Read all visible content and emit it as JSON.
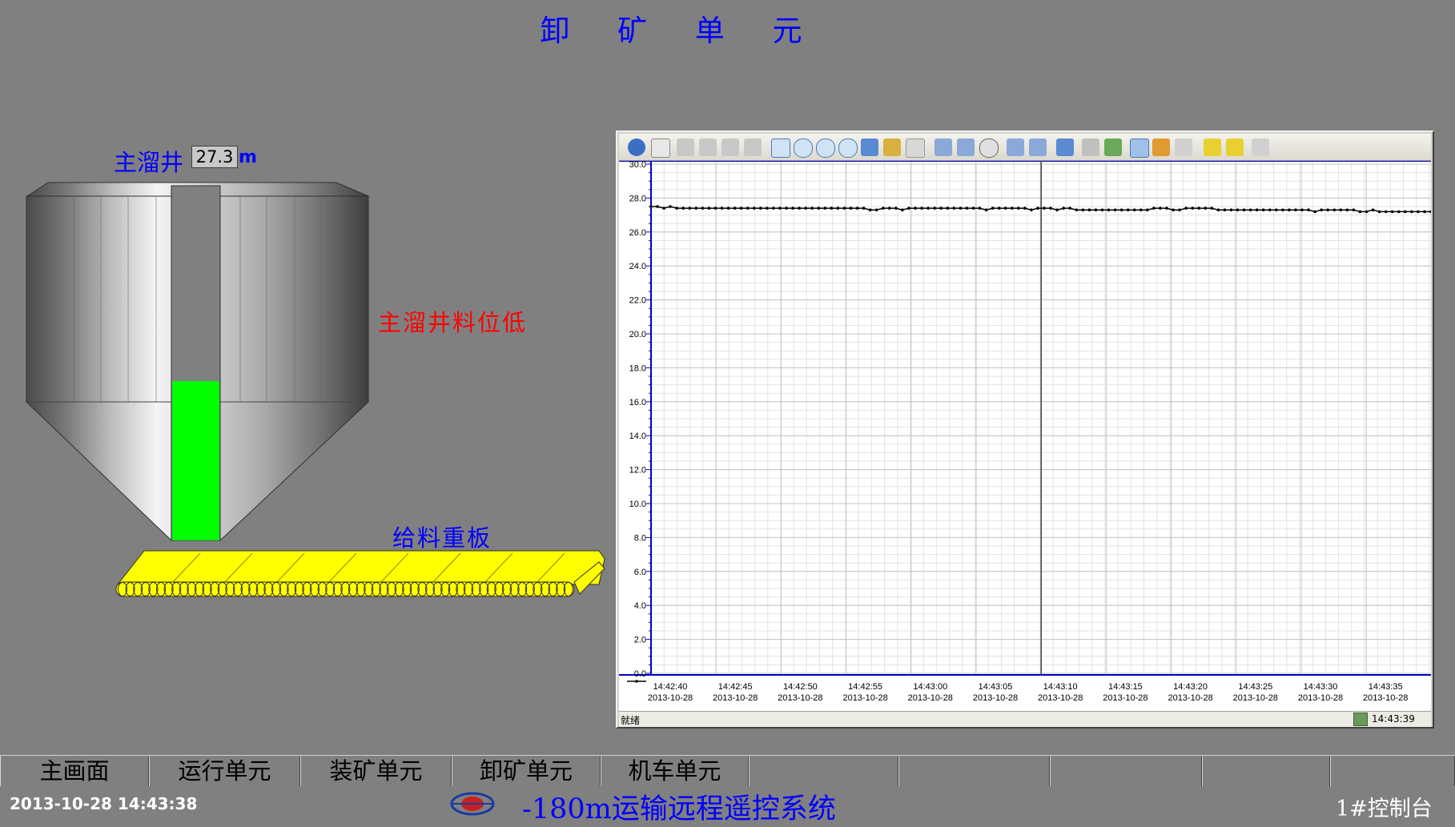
{
  "page": {
    "title": "卸 矿 单 元"
  },
  "shaft": {
    "label": "主溜井",
    "level_value": "27.3",
    "unit": "m",
    "alarm": "主溜井料位低",
    "fill_fraction": 0.45
  },
  "feeder": {
    "label": "给料重板"
  },
  "chart_data": {
    "type": "line",
    "ylim": [
      0,
      30
    ],
    "y_ticks": [
      "0.0",
      "2.0",
      "4.0",
      "6.0",
      "8.0",
      "10.0",
      "12.0",
      "14.0",
      "16.0",
      "18.0",
      "20.0",
      "22.0",
      "24.0",
      "26.0",
      "28.0",
      "30.0"
    ],
    "x_ticks": [
      {
        "time": "14:42:40",
        "date": "2013-10-28"
      },
      {
        "time": "14:42:45",
        "date": "2013-10-28"
      },
      {
        "time": "14:42:50",
        "date": "2013-10-28"
      },
      {
        "time": "14:42:55",
        "date": "2013-10-28"
      },
      {
        "time": "14:43:00",
        "date": "2013-10-28"
      },
      {
        "time": "14:43:05",
        "date": "2013-10-28"
      },
      {
        "time": "14:43:10",
        "date": "2013-10-28"
      },
      {
        "time": "14:43:15",
        "date": "2013-10-28"
      },
      {
        "time": "14:43:20",
        "date": "2013-10-28"
      },
      {
        "time": "14:43:25",
        "date": "2013-10-28"
      },
      {
        "time": "14:43:30",
        "date": "2013-10-28"
      },
      {
        "time": "14:43:35",
        "date": "2013-10-28"
      }
    ],
    "series": [
      {
        "values": [
          27.5,
          27.5,
          27.4,
          27.5,
          27.4,
          27.4,
          27.4,
          27.4,
          27.4,
          27.4,
          27.4,
          27.4,
          27.4,
          27.4,
          27.4,
          27.4,
          27.4,
          27.4,
          27.4,
          27.4,
          27.4,
          27.4,
          27.4,
          27.4,
          27.4,
          27.4,
          27.4,
          27.4,
          27.4,
          27.4,
          27.4,
          27.4,
          27.4,
          27.4,
          27.3,
          27.3,
          27.4,
          27.4,
          27.4,
          27.3,
          27.4,
          27.4,
          27.4,
          27.4,
          27.4,
          27.4,
          27.4,
          27.4,
          27.4,
          27.4,
          27.4,
          27.4,
          27.3,
          27.4,
          27.4,
          27.4,
          27.4,
          27.4,
          27.4,
          27.3,
          27.4,
          27.4,
          27.4,
          27.3,
          27.4,
          27.4,
          27.3,
          27.3,
          27.3,
          27.3,
          27.3,
          27.3,
          27.3,
          27.3,
          27.3,
          27.3,
          27.3,
          27.3,
          27.4,
          27.4,
          27.4,
          27.3,
          27.3,
          27.4,
          27.4,
          27.4,
          27.4,
          27.4,
          27.3,
          27.3,
          27.3,
          27.3,
          27.3,
          27.3,
          27.3,
          27.3,
          27.3,
          27.3,
          27.3,
          27.3,
          27.3,
          27.3,
          27.3,
          27.2,
          27.3,
          27.3,
          27.3,
          27.3,
          27.3,
          27.3,
          27.2,
          27.2,
          27.3,
          27.2,
          27.2,
          27.2,
          27.2,
          27.2,
          27.2,
          27.2,
          27.2,
          27.2
        ]
      }
    ],
    "cursor_time": "14:43:10",
    "grid": true
  },
  "status_bar": {
    "left": "就绪",
    "time": "14:43:39"
  },
  "nav": [
    "主画面",
    "运行单元",
    "装矿单元",
    "卸矿单元",
    "机车单元"
  ],
  "footer": {
    "datetime": "2013-10-28 14:43:38",
    "system_title": "-180m运输远程遥控系统",
    "console": "1#控制台"
  },
  "colors": {
    "title_blue": "#0000ff",
    "alarm_red": "#ff0000",
    "level_green": "#00ff00",
    "feeder_yellow": "#ffff00"
  }
}
